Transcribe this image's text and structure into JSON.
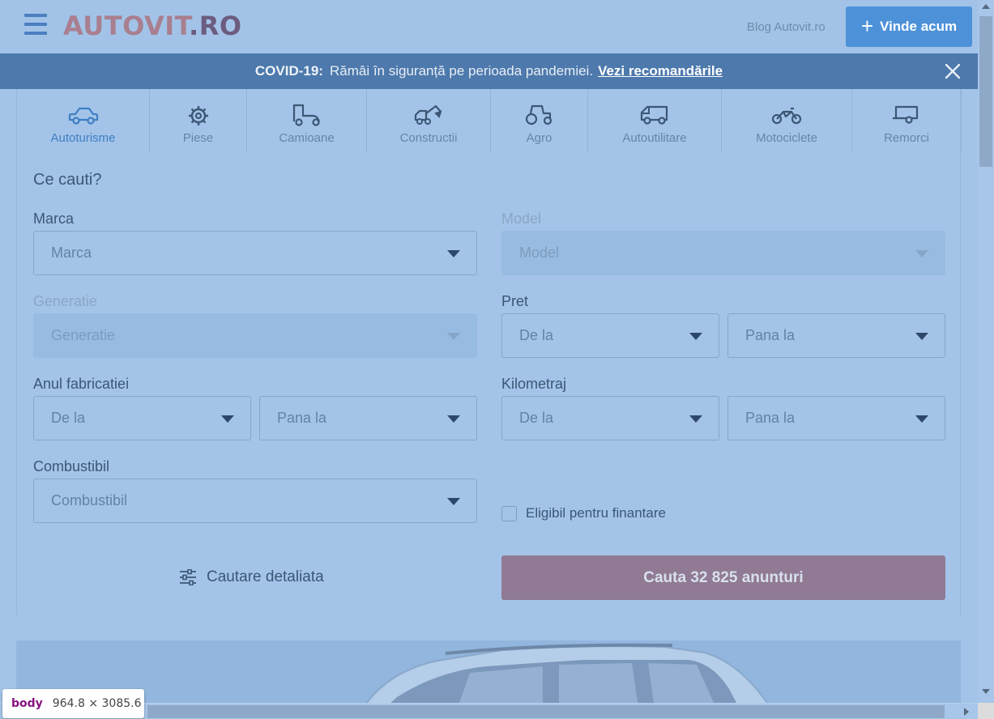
{
  "header": {
    "logo_part1": "AUTOVIT",
    "logo_part2": ".RO",
    "blog_link": "Blog Autovit.ro",
    "sell_button": "Vinde acum"
  },
  "covid_banner": {
    "label": "COVID-19:",
    "message": "Rămâi în siguranță pe perioada pandemiei.",
    "link": "Vezi recomandările"
  },
  "categories": [
    {
      "label": "Autoturisme",
      "icon": "car-icon",
      "active": true
    },
    {
      "label": "Piese",
      "icon": "gear-icon",
      "active": false
    },
    {
      "label": "Camioane",
      "icon": "truck-icon",
      "active": false
    },
    {
      "label": "Constructii",
      "icon": "excavator-icon",
      "active": false
    },
    {
      "label": "Agro",
      "icon": "tractor-icon",
      "active": false
    },
    {
      "label": "Autoutilitare",
      "icon": "van-icon",
      "active": false
    },
    {
      "label": "Motociclete",
      "icon": "motorcycle-icon",
      "active": false
    },
    {
      "label": "Remorci",
      "icon": "trailer-icon",
      "active": false
    }
  ],
  "search": {
    "question": "Ce cauti?",
    "marca": {
      "label": "Marca",
      "placeholder": "Marca"
    },
    "model": {
      "label": "Model",
      "placeholder": "Model",
      "disabled": true
    },
    "generatie": {
      "label": "Generatie",
      "placeholder": "Generatie",
      "disabled": true
    },
    "pret": {
      "label": "Pret",
      "from": "De la",
      "to": "Pana la"
    },
    "an": {
      "label": "Anul fabricatiei",
      "from": "De la",
      "to": "Pana la"
    },
    "km": {
      "label": "Kilometraj",
      "from": "De la",
      "to": "Pana la"
    },
    "combustibil": {
      "label": "Combustibil",
      "placeholder": "Combustibil"
    },
    "finantare_checkbox": "Eligibil pentru finantare",
    "detailed_search": "Cautare detaliata",
    "search_button": "Cauta 32 825 anunturi"
  },
  "devtools_tooltip": {
    "tag": "body",
    "dims": "964.8 × 3085.6"
  },
  "colors": {
    "overlay": "#a3c4e8",
    "sell_button": "#4d91d9",
    "covid_banner": "#4d79ac",
    "search_button": "#907a94"
  }
}
